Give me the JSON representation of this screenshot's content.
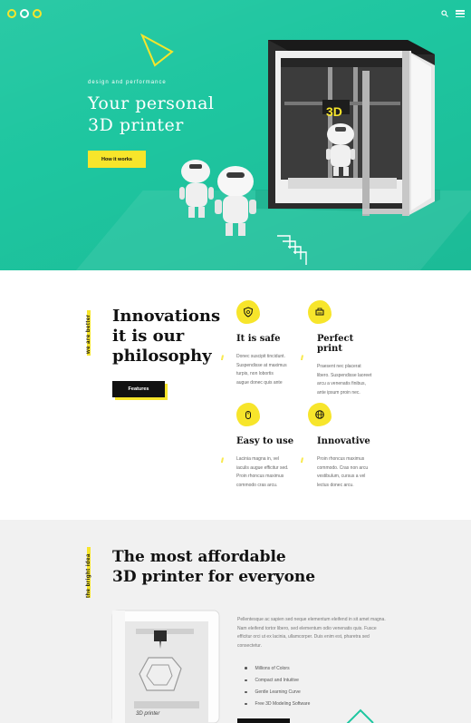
{
  "colors": {
    "teal": "#1ec6a0",
    "yellow": "#f7e52b",
    "dark": "#111111",
    "light_bg": "#f1f1f1"
  },
  "header": {
    "logo_icon": "odo-logo",
    "search_icon": "search-icon",
    "menu_icon": "hamburger-menu-icon"
  },
  "hero": {
    "eyebrow": "design and performance",
    "title_line1": "Your personal",
    "title_line2": "3D printer",
    "button": "How it works",
    "printer_label": "3D"
  },
  "features_section": {
    "tag": "we are better",
    "title_line1": "Innovations",
    "title_line2": "it is our",
    "title_line3": "philosophy",
    "button": "Features",
    "items": [
      {
        "icon": "shield-icon",
        "title": "It is safe",
        "text_1": "Donec suscipit tincidunt.",
        "text_2": "Suspendisse at maximus",
        "text_3": "turpis, non lobortis",
        "text_4": "augue donec quis ante"
      },
      {
        "icon": "printer-icon",
        "title": "Perfect print",
        "text_1": "Praesent nec placerat",
        "text_2": "libero. Suspendisse laoreet",
        "text_3": "arcu a venenatis finibus,",
        "text_4": "ante ipsum proin nec."
      },
      {
        "icon": "mouse-icon",
        "title": "Easy to use",
        "text_1": "Lacinia magna in, vel",
        "text_2": "iaculis augue efficitur sed.",
        "text_3": "Proin rhoncus maximus",
        "text_4": "commodo cras arcu."
      },
      {
        "icon": "globe-icon",
        "title": "Innovative",
        "text_1": "Proin rhoncus maximus",
        "text_2": "commodo. Cras non arcu",
        "text_3": "vestibulum, cursus a vel",
        "text_4": "lectus donec arcu."
      }
    ]
  },
  "bright_section": {
    "tag": "the bright idea",
    "title_line1": "The most affordable",
    "title_line2": "3D printer for everyone",
    "paragraph": "Pellentesque ac sapien sed neque elementum eleifend in sit amet magna. Nam eleifend tortor libero, sed elementum odio venenatis quis. Fusce efficitur orci ut ex lacinia, ullamcorper. Duis enim est, pharetra sed consectetur.",
    "bullets": [
      "Millions of Colors",
      "Compact and Intuitive",
      "Gentle Learning Curve",
      "Free 3D Modeling Software"
    ],
    "printer_label": "3D printer"
  }
}
